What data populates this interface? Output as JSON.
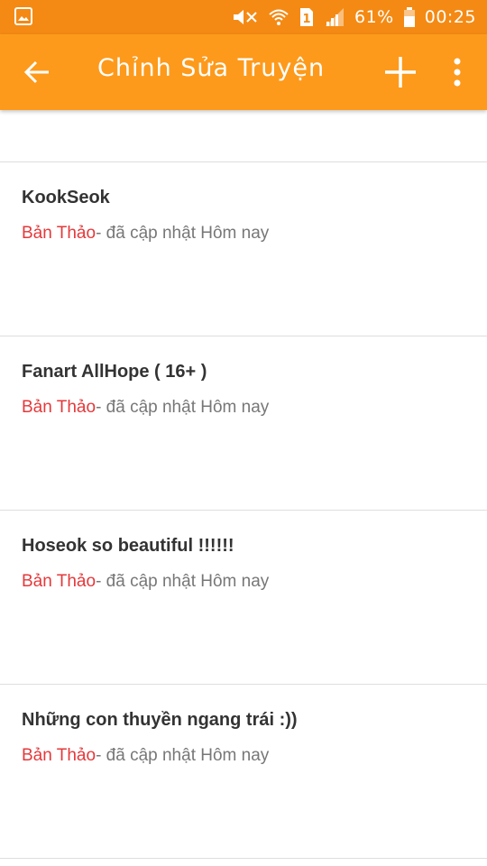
{
  "status_bar": {
    "battery_percent": "61%",
    "time": "00:25",
    "sim_label": "1",
    "icons": [
      "gallery-icon",
      "mute-icon",
      "wifi-icon",
      "sim-icon",
      "signal-icon",
      "battery-icon"
    ]
  },
  "app_bar": {
    "title": "Chỉnh Sửa Truyện",
    "icons": [
      "back-arrow-icon",
      "add-icon",
      "more-vertical-icon"
    ]
  },
  "stories": [
    {
      "title": "KookSeok",
      "status": "Bản Thảo",
      "updated": "- đã cập nhật Hôm nay"
    },
    {
      "title": "Fanart AllHope ( 16+ )",
      "status": "Bản Thảo",
      "updated": "- đã cập nhật Hôm nay"
    },
    {
      "title": "Hoseok so beautiful !!!!!!",
      "status": "Bản Thảo",
      "updated": "- đã cập nhật Hôm nay"
    },
    {
      "title": "Những con thuyền ngang trái :))",
      "status": "Bản Thảo",
      "updated": "- đã cập nhật Hôm nay"
    }
  ],
  "colors": {
    "status_bar": "#f48a14",
    "app_bar": "#fd9a1b",
    "draft_status": "#e5383a",
    "meta_text": "#777777",
    "title_text": "#333333",
    "divider": "#dedede"
  }
}
